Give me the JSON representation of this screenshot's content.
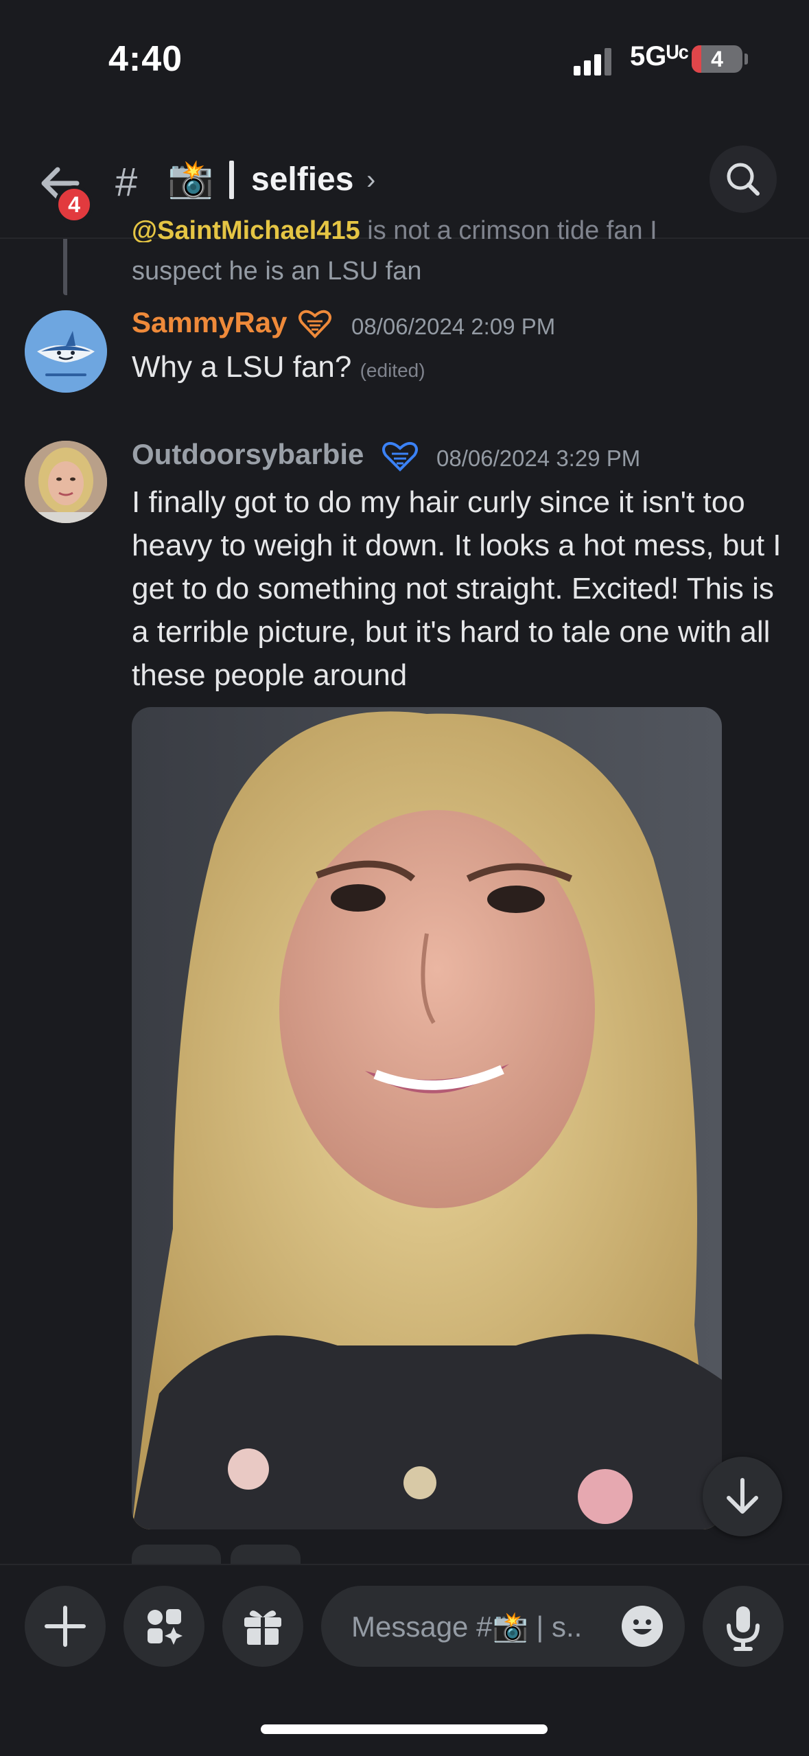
{
  "status_bar": {
    "time": "4:40",
    "network": "5Gᵁᶜ",
    "battery": "4"
  },
  "header": {
    "back_badge": "4",
    "hash": "#",
    "channel_emoji": "📸",
    "channel_name": "selfies",
    "chevron": "›"
  },
  "messages": {
    "reply_preview": {
      "mention": "@SaintMichael415",
      "cut_text": " is not a crimson tide fan I",
      "continuation": "suspect he is an LSU fan"
    },
    "items": [
      {
        "username": "SammyRay",
        "timestamp": "08/06/2024 2:09 PM",
        "text": "Why a LSU fan?",
        "edited": "(edited)",
        "name_color": "#ef8a3a"
      },
      {
        "username": "Outdoorsybarbie",
        "timestamp": "08/06/2024 3:29 PM",
        "text": "I finally got to do my hair curly since it isn't too heavy to weigh it down.  It looks a hot mess, but I get to do something not straight.  Excited!  This is a terrible picture, but it's hard to tale one with all these people around",
        "name_color": "#9aa0a8"
      }
    ]
  },
  "composer": {
    "placeholder": "Message #📸 | s.."
  },
  "colors": {
    "background": "#1a1b1f",
    "surface": "#2b2d31",
    "badge": "#e23a3e",
    "accent_blue": "#3b82f6"
  },
  "icons": [
    "back-arrow-icon",
    "search-icon",
    "heart-orange-icon",
    "heart-blue-icon",
    "arrow-down-icon",
    "plus-icon",
    "apps-icon",
    "gift-icon",
    "emoji-icon",
    "microphone-icon"
  ]
}
